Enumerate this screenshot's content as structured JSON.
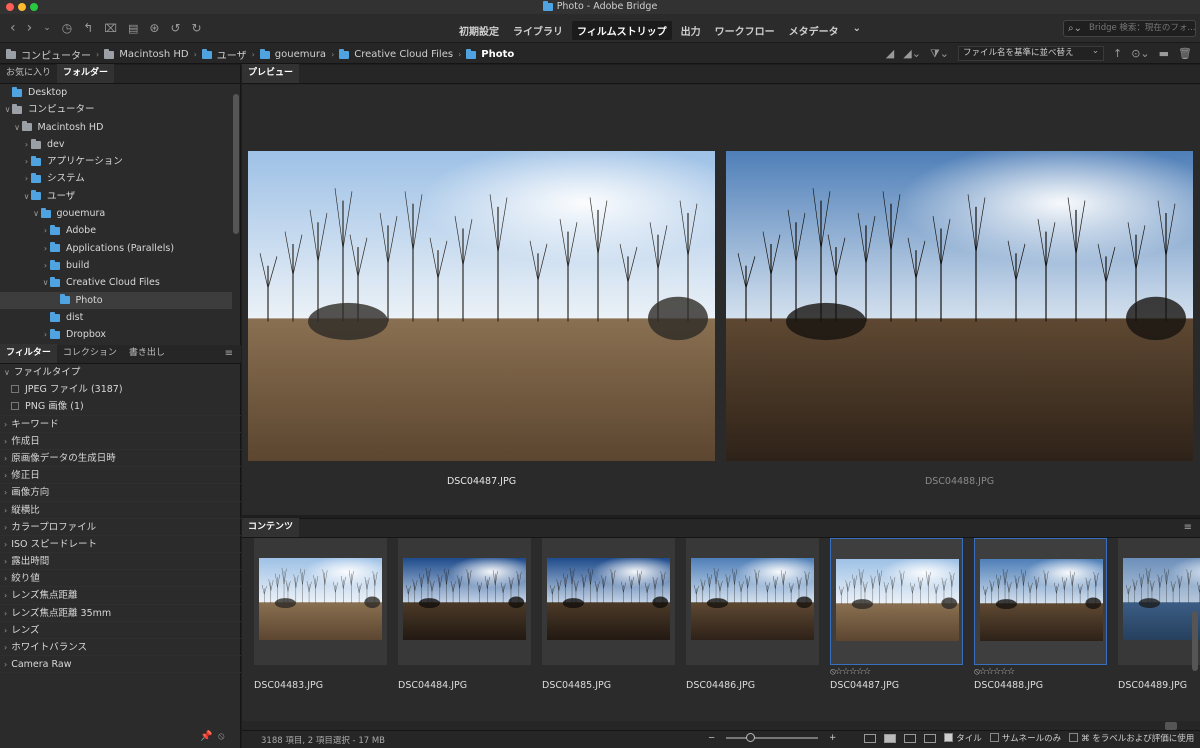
{
  "window": {
    "title": "Photo - Adobe Bridge"
  },
  "workspaces": [
    "初期設定",
    "ライブラリ",
    "フィルムストリップ",
    "出力",
    "ワークフロー",
    "メタデータ"
  ],
  "active_workspace": "フィルムストリップ",
  "search": {
    "placeholder": "Bridge 検索：現在のフォ..."
  },
  "breadcrumb": [
    "コンピューター",
    "Macintosh HD",
    "ユーザ",
    "gouemura",
    "Creative Cloud Files",
    "Photo"
  ],
  "sort": {
    "label": "ファイル名を基準に並べ替え"
  },
  "left_tabs": {
    "favorites": "お気に入り",
    "folders": "フォルダー"
  },
  "folder_tree": [
    {
      "label": "Desktop",
      "depth": 0,
      "expander": "",
      "icon": "blue"
    },
    {
      "label": "コンピューター",
      "depth": 0,
      "expander": "∨",
      "icon": "grey"
    },
    {
      "label": "Macintosh HD",
      "depth": 1,
      "expander": "∨",
      "icon": "grey"
    },
    {
      "label": "dev",
      "depth": 2,
      "expander": "›",
      "icon": "grey"
    },
    {
      "label": "アプリケーション",
      "depth": 2,
      "expander": "›",
      "icon": "blue"
    },
    {
      "label": "システム",
      "depth": 2,
      "expander": "›",
      "icon": "blue"
    },
    {
      "label": "ユーザ",
      "depth": 2,
      "expander": "∨",
      "icon": "blue"
    },
    {
      "label": "gouemura",
      "depth": 3,
      "expander": "∨",
      "icon": "blue"
    },
    {
      "label": "Adobe",
      "depth": 4,
      "expander": "›",
      "icon": "blue"
    },
    {
      "label": "Applications (Parallels)",
      "depth": 4,
      "expander": "›",
      "icon": "blue"
    },
    {
      "label": "build",
      "depth": 4,
      "expander": "›",
      "icon": "blue"
    },
    {
      "label": "Creative Cloud Files",
      "depth": 4,
      "expander": "∨",
      "icon": "blue"
    },
    {
      "label": "Photo",
      "depth": 5,
      "expander": "",
      "icon": "blue",
      "selected": true
    },
    {
      "label": "dist",
      "depth": 4,
      "expander": "",
      "icon": "blue"
    },
    {
      "label": "Dropbox",
      "depth": 4,
      "expander": "›",
      "icon": "blue"
    }
  ],
  "filter_tabs": {
    "filter": "フィルター",
    "collection": "コレクション",
    "export": "書き出し"
  },
  "filter_file_type": {
    "label": "ファイルタイプ",
    "items": [
      {
        "label": "JPEG ファイル",
        "count": "(3187)"
      },
      {
        "label": "PNG 画像",
        "count": "(1)"
      }
    ]
  },
  "filter_groups": [
    "キーワード",
    "作成日",
    "原画像データの生成日時",
    "修正日",
    "画像方向",
    "縦横比",
    "カラープロファイル",
    "ISO スピードレート",
    "露出時間",
    "絞り値",
    "レンズ焦点距離",
    "レンズ焦点距離 35mm",
    "レンズ",
    "ホワイトバランス",
    "Camera Raw"
  ],
  "preview": {
    "tab": "プレビュー",
    "images": [
      {
        "caption": "DSC04487.JPG",
        "variant": "bright"
      },
      {
        "caption": "DSC04488.JPG",
        "variant": "dark"
      }
    ]
  },
  "content": {
    "tab": "コンテンツ",
    "items": [
      {
        "name": "DSC04483.JPG",
        "selected": false,
        "variant": "bright"
      },
      {
        "name": "DSC04484.JPG",
        "selected": false,
        "variant": "deep"
      },
      {
        "name": "DSC04485.JPG",
        "selected": false,
        "variant": "deep"
      },
      {
        "name": "DSC04486.JPG",
        "selected": false,
        "variant": "dark"
      },
      {
        "name": "DSC04487.JPG",
        "selected": true,
        "variant": "bright",
        "rating": "⦸☆☆☆☆☆"
      },
      {
        "name": "DSC04488.JPG",
        "selected": true,
        "variant": "dark",
        "rating": "⦸☆☆☆☆☆"
      },
      {
        "name": "DSC04489.JPG",
        "selected": false,
        "variant": "water"
      }
    ]
  },
  "status": {
    "info": "3188 項目, 2 項目選択 - 17 MB",
    "tile_label": "タイル",
    "thumbnail_only_label": "サムネールのみ",
    "label_rating_label": "⌘ をラベルおよび評価に使用"
  }
}
